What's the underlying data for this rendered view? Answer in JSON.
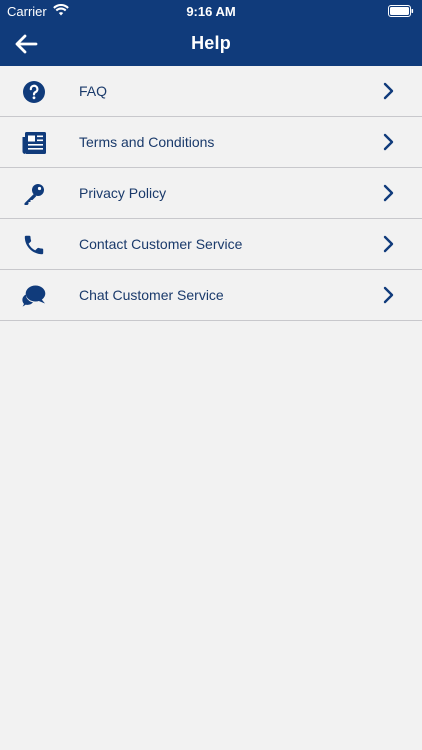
{
  "status_bar": {
    "carrier": "Carrier",
    "time": "9:16 AM"
  },
  "nav": {
    "title": "Help",
    "back_icon": "arrow-left-icon"
  },
  "colors": {
    "header": "#103b7b",
    "icon": "#103b7b",
    "label": "#1a3a6b",
    "background": "#f2f2f2",
    "divider": "#c8c8cc"
  },
  "menu": {
    "items": [
      {
        "label": "FAQ",
        "icon": "question-circle-icon"
      },
      {
        "label": "Terms and Conditions",
        "icon": "document-icon"
      },
      {
        "label": "Privacy Policy",
        "icon": "key-icon"
      },
      {
        "label": "Contact Customer Service",
        "icon": "phone-icon"
      },
      {
        "label": "Chat Customer Service",
        "icon": "chat-bubbles-icon"
      }
    ]
  }
}
